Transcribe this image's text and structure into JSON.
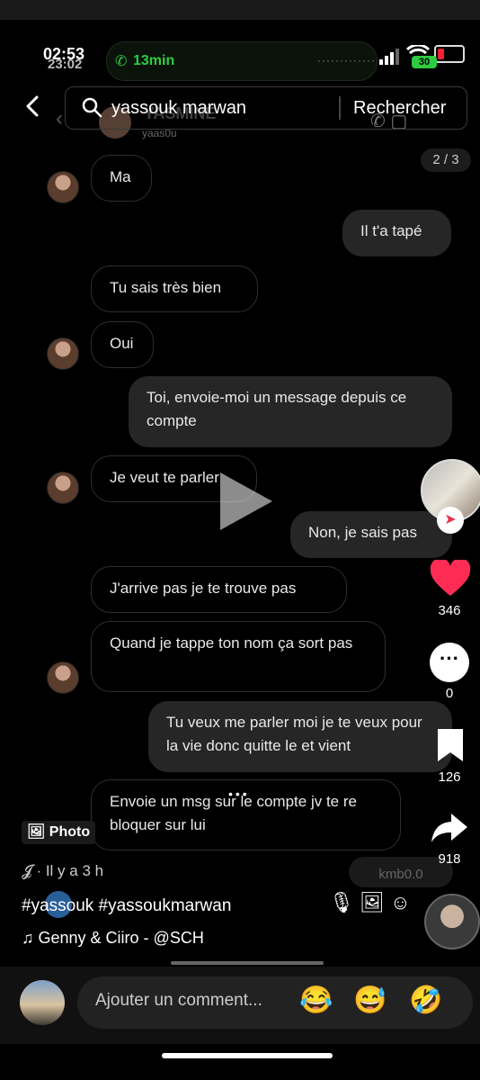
{
  "status": {
    "time": "02:53",
    "time_ghost": "23:02",
    "call_duration": "13min",
    "battery_label": "30"
  },
  "search": {
    "query": "yassouk marwan",
    "button": "Rechercher"
  },
  "ghost_header": {
    "name": "YASMINE",
    "handle": "yaas0u"
  },
  "page_counter": "2 / 3",
  "messages": [
    {
      "dir": "in",
      "text": "Ma"
    },
    {
      "dir": "out",
      "text": "Il t'a tapé"
    },
    {
      "dir": "in",
      "text": "Tu sais très bien"
    },
    {
      "dir": "in",
      "text": "Oui"
    },
    {
      "dir": "out",
      "text": "Toi, envoie-moi un message depuis ce compte"
    },
    {
      "dir": "in",
      "text": "Je veut te parler"
    },
    {
      "dir": "out",
      "text": "Non, je sais pas"
    },
    {
      "dir": "in",
      "text": "J'arrive pas je te trouve pas"
    },
    {
      "dir": "in",
      "text": "Quand je tappe ton nom ça sort pas"
    },
    {
      "dir": "out",
      "text": "Tu veux me parler moi je te veux pour la vie donc quitte le et vient"
    },
    {
      "dir": "in",
      "text": "Envoie un msg sur le compte jv te re bloquer sur lui"
    },
    {
      "dir": "out",
      "text": "kmb0.0"
    }
  ],
  "side_actions": {
    "likes": "346",
    "comments": "0",
    "saves": "126",
    "shares": "918"
  },
  "post": {
    "photo_label": "Photo",
    "time": "\u0001 · Il y a 3 h",
    "hashtags": "#yassouk #yassoukmarwan",
    "music": "Genny & Ciiro - @SCH"
  },
  "comment_input": {
    "placeholder": "Ajouter un comment..."
  },
  "emojis": [
    "😂",
    "😅",
    "🤣"
  ],
  "icons": {
    "back": "back-chevron-icon",
    "search": "search-icon",
    "heart": "heart-icon",
    "comment": "comment-icon",
    "bookmark": "bookmark-icon",
    "share": "share-icon",
    "music": "music-note-icon",
    "photo": "photo-icon"
  },
  "colors": {
    "like": "#fe2c55",
    "call": "#2ecc40",
    "bubble_out": "#262626"
  }
}
